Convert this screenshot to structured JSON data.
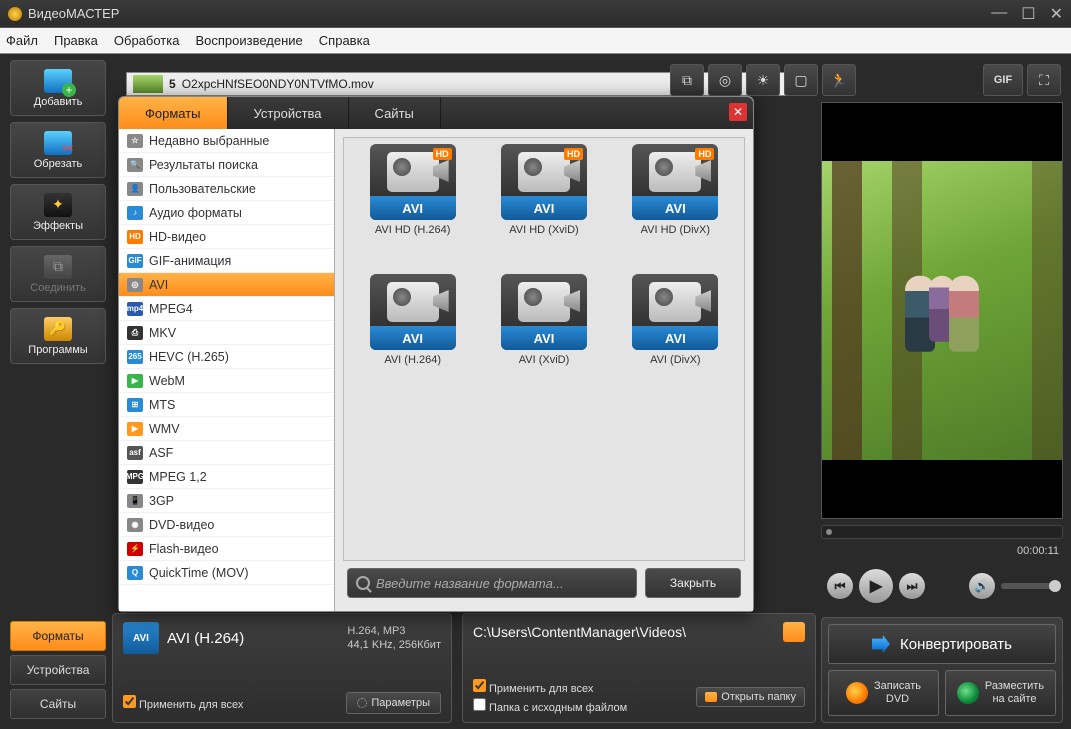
{
  "app_title": "ВидеоМАСТЕР",
  "menu": [
    "Файл",
    "Правка",
    "Обработка",
    "Воспроизведение",
    "Справка"
  ],
  "left_tools": {
    "add": "Добавить",
    "cut": "Обрезать",
    "fx": "Эффекты",
    "join": "Соединить",
    "programs": "Программы"
  },
  "left_tabs": {
    "formats": "Форматы",
    "devices": "Устройства",
    "sites": "Сайты"
  },
  "toolbar_gif": "GIF",
  "file_row": {
    "num": "5",
    "name": "O2xpcHNfSEO0NDY0NTVfMO.mov"
  },
  "popup": {
    "tabs": {
      "formats": "Форматы",
      "devices": "Устройства",
      "sites": "Сайты"
    },
    "categories": [
      {
        "label": "Недавно выбранные",
        "ic": "☆",
        "bg": "#888"
      },
      {
        "label": "Результаты поиска",
        "ic": "🔍",
        "bg": "#888"
      },
      {
        "label": "Пользовательские",
        "ic": "👤",
        "bg": "#888"
      },
      {
        "label": "Аудио форматы",
        "ic": "♪",
        "bg": "#2a8ad4"
      },
      {
        "label": "HD-видео",
        "ic": "HD",
        "bg": "#ff7b00"
      },
      {
        "label": "GIF-анимация",
        "ic": "GIF",
        "bg": "#2a8ad4"
      },
      {
        "label": "AVI",
        "ic": "◎",
        "bg": "#888",
        "selected": true
      },
      {
        "label": "MPEG4",
        "ic": "mp4",
        "bg": "#2a5aad"
      },
      {
        "label": "MKV",
        "ic": "⎙",
        "bg": "#333"
      },
      {
        "label": "HEVC (H.265)",
        "ic": "265",
        "bg": "#2a8ad4"
      },
      {
        "label": "WebM",
        "ic": "▶",
        "bg": "#39b54a"
      },
      {
        "label": "MTS",
        "ic": "⊞",
        "bg": "#2a8ad4"
      },
      {
        "label": "WMV",
        "ic": "▶",
        "bg": "#ff9a1e"
      },
      {
        "label": "ASF",
        "ic": "asf",
        "bg": "#555"
      },
      {
        "label": "MPEG 1,2",
        "ic": "MPG",
        "bg": "#333"
      },
      {
        "label": "3GP",
        "ic": "📱",
        "bg": "#888"
      },
      {
        "label": "DVD-видео",
        "ic": "◉",
        "bg": "#888"
      },
      {
        "label": "Flash-видео",
        "ic": "⚡",
        "bg": "#cc0000"
      },
      {
        "label": "QuickTime (MOV)",
        "ic": "Q",
        "bg": "#2a8ad4"
      }
    ],
    "presets": [
      {
        "fmt": "AVI",
        "label": "AVI HD (H.264)",
        "hd": true
      },
      {
        "fmt": "AVI",
        "label": "AVI HD (XviD)",
        "hd": true
      },
      {
        "fmt": "AVI",
        "label": "AVI HD (DivX)",
        "hd": true
      },
      {
        "fmt": "AVI",
        "label": "AVI (H.264)",
        "hd": false
      },
      {
        "fmt": "AVI",
        "label": "AVI (XviD)",
        "hd": false
      },
      {
        "fmt": "AVI",
        "label": "AVI (DivX)",
        "hd": false
      }
    ],
    "search_placeholder": "Введите название формата...",
    "close": "Закрыть"
  },
  "bottom": {
    "fmt_icon": "AVI",
    "fmt_name": "AVI (H.264)",
    "fmt_line1": "H.264, MP3",
    "fmt_line2": "44,1 KHz, 256Кбит",
    "apply_all": "Применить для всех",
    "params": "Параметры",
    "path": "C:\\Users\\ContentManager\\Videos\\",
    "same_folder": "Папка с исходным файлом",
    "open_folder": "Открыть папку"
  },
  "player": {
    "time": "00:00:11"
  },
  "actions": {
    "convert": "Конвертировать",
    "dvd_l1": "Записать",
    "dvd_l2": "DVD",
    "web_l1": "Разместить",
    "web_l2": "на сайте"
  }
}
